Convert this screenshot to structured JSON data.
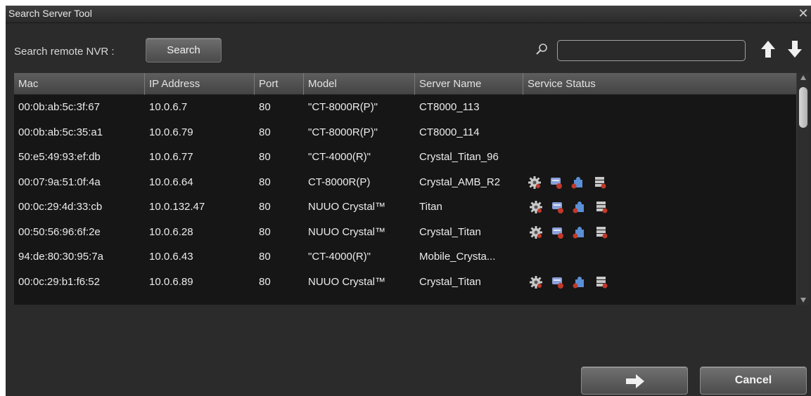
{
  "window": {
    "title": "Search Server Tool",
    "close_glyph": "✕"
  },
  "search": {
    "label": "Search remote NVR :",
    "button_label": "Search",
    "filter_value": "",
    "icons": [
      "magnifier-icon",
      "arrow-up-icon",
      "arrow-down-icon"
    ]
  },
  "table": {
    "columns": [
      "Mac",
      "IP Address",
      "Port",
      "Model",
      "Server Name",
      "Service Status"
    ],
    "rows": [
      {
        "mac": "00:0b:ab:5c:3f:67",
        "ip": "10.0.6.7",
        "port": "80",
        "model": "\"CT-8000R(P)\"",
        "name": "CT8000_113",
        "status_icons": false
      },
      {
        "mac": "00:0b:ab:5c:35:a1",
        "ip": "10.0.6.79",
        "port": "80",
        "model": "\"CT-8000R(P)\"",
        "name": "CT8000_114",
        "status_icons": false
      },
      {
        "mac": "50:e5:49:93:ef:db",
        "ip": "10.0.6.77",
        "port": "80",
        "model": "\"CT-4000(R)\"",
        "name": "Crystal_Titan_96",
        "status_icons": false
      },
      {
        "mac": "00:07:9a:51:0f:4a",
        "ip": "10.0.6.64",
        "port": "80",
        "model": "CT-8000R(P)",
        "name": "Crystal_AMB_R2",
        "status_icons": true
      },
      {
        "mac": "00:0c:29:4d:33:cb",
        "ip": "10.0.132.47",
        "port": "80",
        "model": "NUUO Crystal™",
        "name": "Titan",
        "status_icons": true
      },
      {
        "mac": "00:50:56:96:6f:2e",
        "ip": "10.0.6.28",
        "port": "80",
        "model": "NUUO Crystal™",
        "name": "Crystal_Titan",
        "status_icons": true
      },
      {
        "mac": "94:de:80:30:95:7a",
        "ip": "10.0.6.43",
        "port": "80",
        "model": "\"CT-4000(R)\"",
        "name": "Mobile_Crysta...",
        "status_icons": false
      },
      {
        "mac": "00:0c:29:b1:f6:52",
        "ip": "10.0.6.89",
        "port": "80",
        "model": "NUUO Crystal™",
        "name": "Crystal_Titan",
        "status_icons": true
      }
    ],
    "status_icon_names": [
      "gear-service-icon",
      "shield-icon",
      "puzzle-icon",
      "database-icon"
    ]
  },
  "footer": {
    "next_icon": "arrow-right-icon",
    "cancel_label": "Cancel"
  },
  "colors": {
    "background": "#2b2b2b",
    "grid": "#161616",
    "header": "#4f4f4f",
    "text": "#ececec"
  }
}
